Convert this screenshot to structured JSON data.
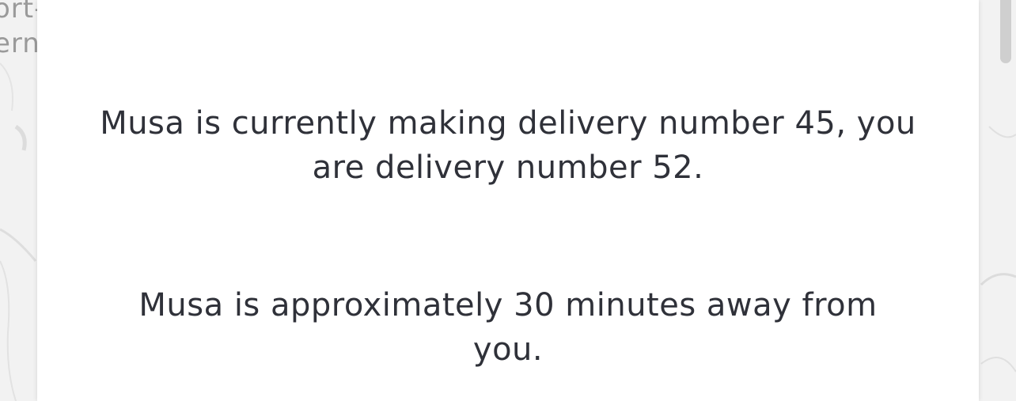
{
  "map": {
    "label_line1": "ort-",
    "label_line2": "ern"
  },
  "modal": {
    "delivery_status": {
      "line1": "Musa is currently making delivery number 45, you",
      "line2": "are delivery number 52."
    },
    "eta": {
      "line1": "Musa is approximately 30 minutes away from",
      "line2": "you."
    }
  }
}
